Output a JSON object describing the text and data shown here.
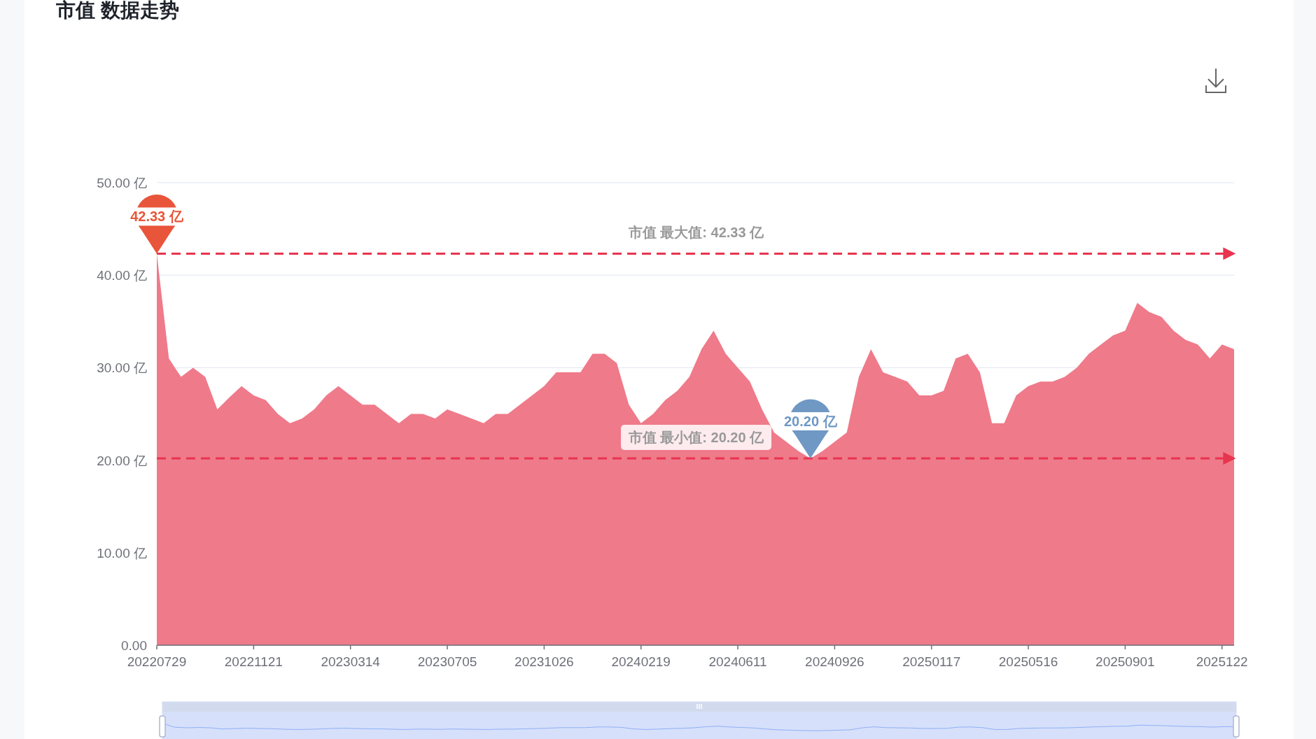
{
  "title": "市值 数据走势",
  "chart": {
    "chart_data": {
      "type": "area",
      "ylim": [
        0,
        50
      ],
      "categories": [
        "20220729",
        null,
        null,
        null,
        null,
        null,
        null,
        null,
        "20221121",
        null,
        null,
        null,
        null,
        null,
        null,
        null,
        "20230314",
        null,
        null,
        null,
        null,
        null,
        null,
        null,
        "20230705",
        null,
        null,
        null,
        null,
        null,
        null,
        null,
        "20231026",
        null,
        null,
        null,
        null,
        null,
        null,
        null,
        "20240219",
        null,
        null,
        null,
        null,
        null,
        null,
        null,
        "20240611",
        null,
        null,
        null,
        null,
        null,
        null,
        null,
        "20240926",
        null,
        null,
        null,
        null,
        null,
        null,
        null,
        "20250117",
        null,
        null,
        null,
        null,
        null,
        null,
        null,
        "20250516",
        null,
        null,
        null,
        null,
        null,
        null,
        null,
        "20250901",
        null,
        null,
        null,
        null,
        null,
        null,
        null,
        "2025122",
        null
      ],
      "yticks": [
        {
          "value": 0,
          "label": "0.00"
        },
        {
          "value": 10,
          "label": "10.00 亿"
        },
        {
          "value": 20,
          "label": "20.00 亿"
        },
        {
          "value": 30,
          "label": "30.00 亿"
        },
        {
          "value": 40,
          "label": "40.00 亿"
        },
        {
          "value": 50,
          "label": "50.00 亿"
        }
      ],
      "series": [
        {
          "color": "#ef7a8a",
          "values": [
            42.33,
            31,
            29,
            30,
            29,
            25.5,
            26.8,
            28,
            27,
            26.5,
            25,
            24,
            24.5,
            25.5,
            27,
            28,
            27,
            26,
            26,
            25,
            24,
            25,
            25,
            24.5,
            25.5,
            25,
            24.5,
            24,
            25,
            25,
            26,
            27,
            28,
            29.5,
            29.5,
            29.5,
            31.5,
            31.5,
            30.5,
            26,
            24,
            25,
            26.5,
            27.5,
            29,
            32,
            34,
            31.5,
            30,
            28.5,
            25.5,
            23,
            22,
            21,
            20.2,
            21,
            22,
            23,
            29,
            32,
            29.5,
            29,
            28.5,
            27,
            27,
            27.5,
            31,
            31.5,
            29.5,
            24,
            24,
            27,
            28,
            28.5,
            28.5,
            29,
            30,
            31.5,
            32.5,
            33.5,
            34,
            37,
            36,
            35.5,
            34,
            33,
            32.5,
            31,
            32.5,
            32
          ]
        }
      ],
      "ref_lines": [
        {
          "axis": "y",
          "value": 42.33,
          "label": "市值 最大值: 42.33 亿"
        },
        {
          "axis": "y",
          "value": 20.2,
          "label": "市值 最小值: 20.20 亿"
        }
      ],
      "annotations": [
        {
          "text": "42.33 亿",
          "x": "20220729",
          "y": 42.33
        },
        {
          "text": "20.20 亿",
          "y": 20.2
        }
      ]
    },
    "zoom_slider": {
      "level": 1
    }
  }
}
